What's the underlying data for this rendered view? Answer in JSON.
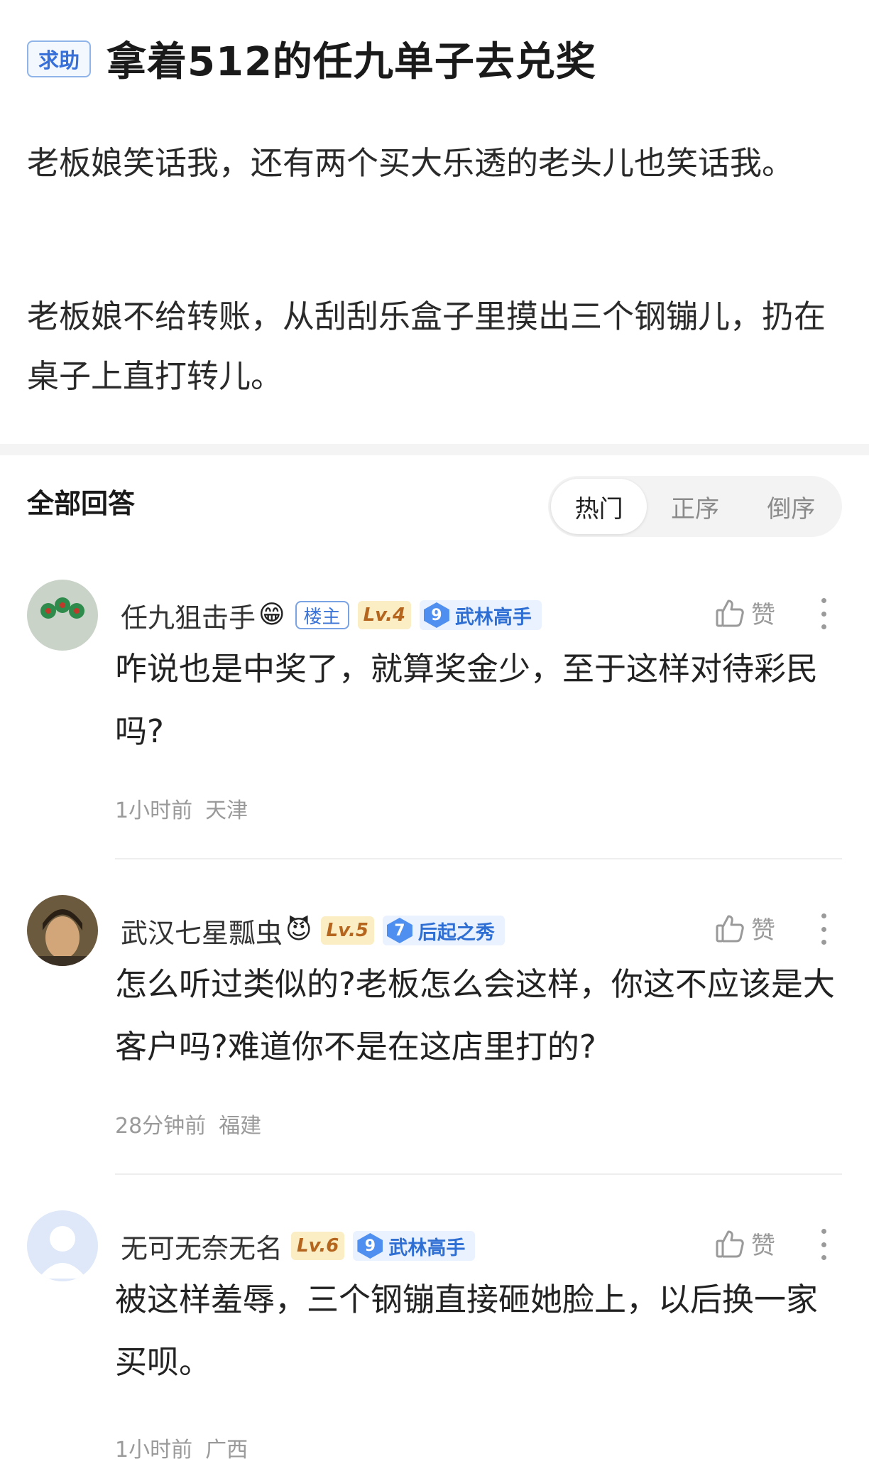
{
  "post": {
    "tag": "求助",
    "title": "拿着512的任九单子去兑奖",
    "paragraphs": [
      "老板娘笑话我，还有两个买大乐透的老头儿也笑话我。",
      "老板娘不给转账，从刮刮乐盒子里摸出三个钢镚儿，扔在桌子上直打转儿。"
    ]
  },
  "answers": {
    "section_title": "全部回答",
    "sort_tabs": [
      "热门",
      "正序",
      "倒序"
    ],
    "active_sort": "热门"
  },
  "comments": [
    {
      "username": "任九狙击手",
      "emoji": "😁",
      "owner_badge": "楼主",
      "level": "Lv.4",
      "rank_num": "9",
      "rank_title": "武林高手",
      "like_label": "赞",
      "text": "咋说也是中奖了，就算奖金少，至于这样对待彩民吗?",
      "time": "1小时前",
      "location": "天津"
    },
    {
      "username": "武汉七星瓢虫",
      "emoji": "😈",
      "level": "Lv.5",
      "rank_num": "7",
      "rank_title": "后起之秀",
      "like_label": "赞",
      "text": "怎么听过类似的?老板怎么会这样，你这不应该是大客户吗?难道你不是在这店里打的?",
      "time": "28分钟前",
      "location": "福建"
    },
    {
      "username": "无可无奈无名",
      "level": "Lv.6",
      "rank_num": "9",
      "rank_title": "武林高手",
      "like_label": "赞",
      "text": "被这样羞辱，三个钢镚直接砸她脸上，以后换一家买呗。",
      "time": "1小时前",
      "location": "广西"
    }
  ],
  "colors": {
    "accent_blue": "#3770d8",
    "level_bg": "#fbeec4",
    "level_fg": "#b5651d",
    "muted": "#9a9a9a"
  }
}
